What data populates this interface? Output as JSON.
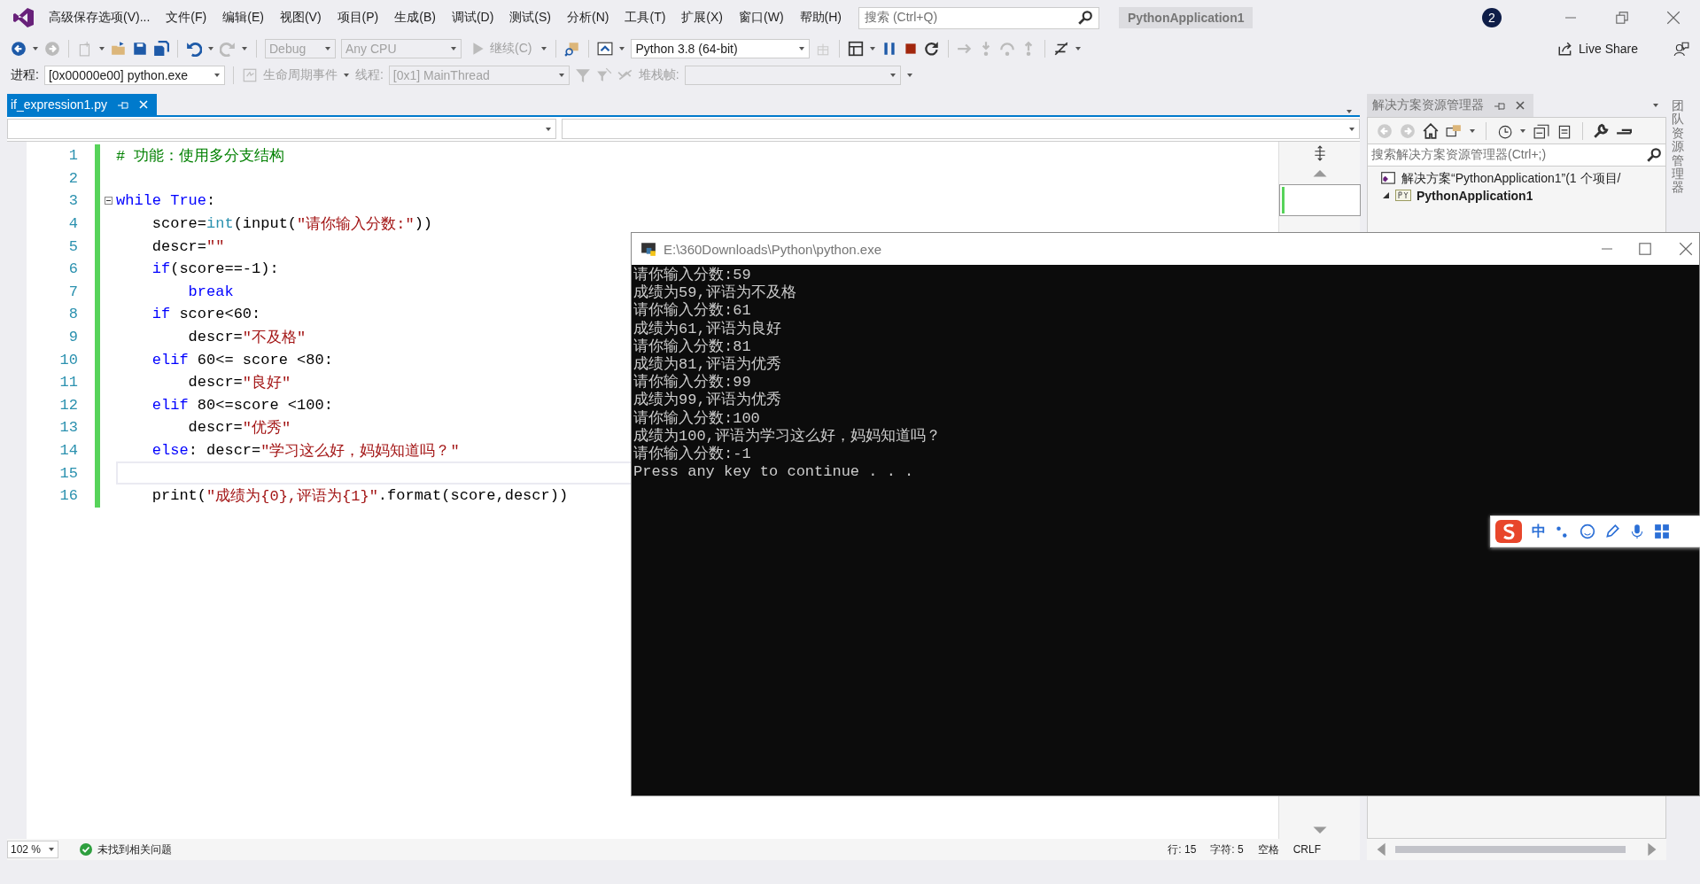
{
  "menu": {
    "items": [
      "高级保存选项(V)...",
      "文件(F)",
      "编辑(E)",
      "视图(V)",
      "项目(P)",
      "生成(B)",
      "调试(D)",
      "测试(S)",
      "分析(N)",
      "工具(T)",
      "扩展(X)",
      "窗口(W)",
      "帮助(H)"
    ]
  },
  "search": {
    "placeholder": "搜索 (Ctrl+Q)"
  },
  "solution_name": "PythonApplication1",
  "notification_count": "2",
  "toolbar": {
    "configuration": "Debug",
    "platform": "Any CPU",
    "continue": "继续(C)",
    "environment": "Python 3.8 (64-bit)",
    "live_share": "Live Share"
  },
  "debug_bar": {
    "process_label": "进程:",
    "process": "[0x00000e00] python.exe",
    "lifecycle": "生命周期事件",
    "thread_label": "线程:",
    "thread": "[0x1] MainThread",
    "stack_label": "堆栈帧:"
  },
  "document_tabs": [
    {
      "label": "if_expression1.py",
      "selected": true
    }
  ],
  "editor": {
    "lines": [
      {
        "number": "1",
        "current": false,
        "fold": false,
        "tokens": [
          {
            "kind": "comment",
            "text": "# 功能：使用多分支结构"
          }
        ]
      },
      {
        "number": "2",
        "current": false,
        "fold": false
      },
      {
        "number": "3",
        "current": false,
        "fold": true,
        "tokens": [
          {
            "kind": "keyword",
            "text": "while"
          },
          {
            "kind": "keyword",
            "text": " True"
          },
          {
            "kind": "plain",
            "text": ":"
          }
        ]
      },
      {
        "number": "4",
        "current": false,
        "fold": false,
        "tokens": [
          {
            "kind": "plain",
            "text": "    score="
          },
          {
            "kind": "builtin",
            "text": "int"
          },
          {
            "kind": "plain",
            "text": "(input("
          },
          {
            "kind": "string",
            "text": "\"请你输入分数:\""
          },
          {
            "kind": "plain",
            "text": "))"
          }
        ]
      },
      {
        "number": "5",
        "current": false,
        "fold": false,
        "tokens": [
          {
            "kind": "plain",
            "text": "    descr="
          },
          {
            "kind": "string",
            "text": "\"\""
          }
        ]
      },
      {
        "number": "6",
        "current": false,
        "fold": false,
        "tokens": [
          {
            "kind": "keyword",
            "text": "    if"
          },
          {
            "kind": "plain",
            "text": "(score==-1):"
          }
        ]
      },
      {
        "number": "7",
        "current": false,
        "fold": false,
        "tokens": [
          {
            "kind": "keyword",
            "text": "        break"
          }
        ]
      },
      {
        "number": "8",
        "current": false,
        "fold": false,
        "tokens": [
          {
            "kind": "keyword",
            "text": "    if"
          },
          {
            "kind": "plain",
            "text": " score<60:"
          }
        ]
      },
      {
        "number": "9",
        "current": false,
        "fold": false,
        "tokens": [
          {
            "kind": "plain",
            "text": "        descr="
          },
          {
            "kind": "string",
            "text": "\"不及格\""
          }
        ]
      },
      {
        "number": "10",
        "current": false,
        "fold": false,
        "tokens": [
          {
            "kind": "keyword",
            "text": "    elif"
          },
          {
            "kind": "plain",
            "text": " 60<= score <80:"
          }
        ]
      },
      {
        "number": "11",
        "current": false,
        "fold": false,
        "tokens": [
          {
            "kind": "plain",
            "text": "        descr="
          },
          {
            "kind": "string",
            "text": "\"良好\""
          }
        ]
      },
      {
        "number": "12",
        "current": false,
        "fold": false,
        "tokens": [
          {
            "kind": "keyword",
            "text": "    elif"
          },
          {
            "kind": "plain",
            "text": " 80<=score <100:"
          }
        ]
      },
      {
        "number": "13",
        "current": false,
        "fold": false,
        "tokens": [
          {
            "kind": "plain",
            "text": "        descr="
          },
          {
            "kind": "string",
            "text": "\"优秀\""
          }
        ]
      },
      {
        "number": "14",
        "current": false,
        "fold": false,
        "tokens": [
          {
            "kind": "keyword",
            "text": "    else"
          },
          {
            "kind": "plain",
            "text": ": descr="
          },
          {
            "kind": "string",
            "text": "\"学习这么好，妈妈知道吗？\""
          }
        ]
      },
      {
        "number": "15",
        "current": true,
        "fold": false
      },
      {
        "number": "16",
        "current": false,
        "fold": false,
        "tokens": [
          {
            "kind": "plain",
            "text": "    print("
          },
          {
            "kind": "string",
            "text": "\"成绩为{0},评语为{1}\""
          },
          {
            "kind": "plain",
            "text": ".format(score,descr))"
          }
        ]
      }
    ]
  },
  "editor_status": {
    "zoom": "102 %",
    "issues": "未找到相关问题",
    "line": "行: 15",
    "column": "字符: 5",
    "indent": "空格",
    "line_ending": "CRLF"
  },
  "solution_explorer": {
    "title": "解决方案资源管理器",
    "search_placeholder": "搜索解决方案资源管理器(Ctrl+;)",
    "tree": [
      {
        "label": "解决方案“PythonApplication1”(1 个项目/",
        "children": [
          {
            "label": "PythonApplication1",
            "expanded": true
          }
        ]
      }
    ]
  },
  "side_tab": "团队资源管理器",
  "console": {
    "title": "E:\\360Downloads\\Python\\python.exe",
    "lines": [
      "请你输入分数:59",
      "成绩为59,评语为不及格",
      "请你输入分数:61",
      "成绩为61,评语为良好",
      "请你输入分数:81",
      "成绩为81,评语为优秀",
      "请你输入分数:99",
      "成绩为99,评语为优秀",
      "请你输入分数:100",
      "成绩为100,评语为学习这么好，妈妈知道吗？",
      "请你输入分数:-1",
      "Press any key to continue . . ."
    ]
  },
  "ime": {
    "mode": "中"
  }
}
